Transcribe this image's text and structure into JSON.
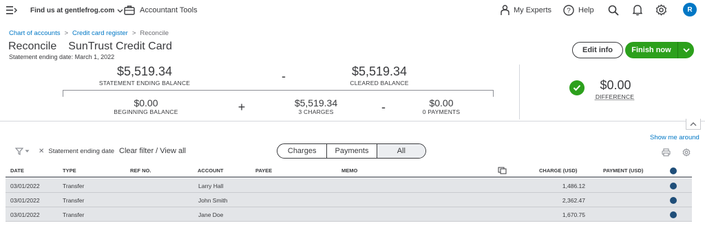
{
  "topbar": {
    "find_us": "Find us at gentlefrog.com",
    "accountant_tools": "Accountant Tools",
    "my_experts": "My Experts",
    "help": "Help",
    "avatar_initial": "R"
  },
  "breadcrumb": {
    "items": [
      "Chart of accounts",
      "Credit card register"
    ],
    "current": "Reconcile",
    "separator": ">"
  },
  "header": {
    "title": "Reconcile",
    "account_name": "SunTrust Credit Card",
    "statement_date": "Statement ending date: March 1, 2022",
    "edit_info": "Edit info",
    "finish_now": "Finish now"
  },
  "summary": {
    "statement_ending_balance": "$5,519.34",
    "statement_ending_balance_label": "STATEMENT ENDING BALANCE",
    "minus_op": "-",
    "cleared_balance": "$5,519.34",
    "cleared_balance_label": "CLEARED BALANCE",
    "beginning_balance": "$0.00",
    "beginning_balance_label": "BEGINNING BALANCE",
    "plus_op": "+",
    "charges": "$5,519.34",
    "charges_label": "3 CHARGES",
    "minus_op2": "-",
    "payments": "$0.00",
    "payments_label": "0 PAYMENTS",
    "difference": "$0.00",
    "difference_label": "DIFFERENCE"
  },
  "show_me_around": "Show me around",
  "filter": {
    "chip_label": "Statement ending date",
    "clear_filter": "Clear filter / View all",
    "tabs": [
      "Charges",
      "Payments",
      "All"
    ],
    "active_tab": "All"
  },
  "table": {
    "headers": [
      "DATE",
      "TYPE",
      "REF NO.",
      "ACCOUNT",
      "PAYEE",
      "MEMO",
      "CHARGE (USD)",
      "PAYMENT (USD)"
    ],
    "rows": [
      {
        "date": "03/01/2022",
        "type": "Transfer",
        "ref": "",
        "account": "Larry Hall",
        "payee": "",
        "memo": "",
        "charge": "1,486.12",
        "payment": "",
        "cleared": true
      },
      {
        "date": "03/01/2022",
        "type": "Transfer",
        "ref": "",
        "account": "John Smith",
        "payee": "",
        "memo": "",
        "charge": "2,362.47",
        "payment": "",
        "cleared": true
      },
      {
        "date": "03/01/2022",
        "type": "Transfer",
        "ref": "",
        "account": "Jane Doe",
        "payee": "",
        "memo": "",
        "charge": "1,670.75",
        "payment": "",
        "cleared": true
      }
    ]
  },
  "colors": {
    "accent_green": "#2ca01c",
    "link_blue": "#0077c5",
    "check_navy": "#1f4e79",
    "avatar_blue": "#0077c5",
    "row_bg": "#e3e5e8"
  },
  "icons": {
    "menu": "hamburger-menu-icon",
    "briefcase": "briefcase-icon",
    "experts": "person-icon",
    "help": "help-circle-icon",
    "search": "search-icon",
    "bell": "bell-icon",
    "settings": "gear-icon",
    "filter": "filter-icon",
    "print": "printer-icon",
    "copy": "copy-icon"
  }
}
